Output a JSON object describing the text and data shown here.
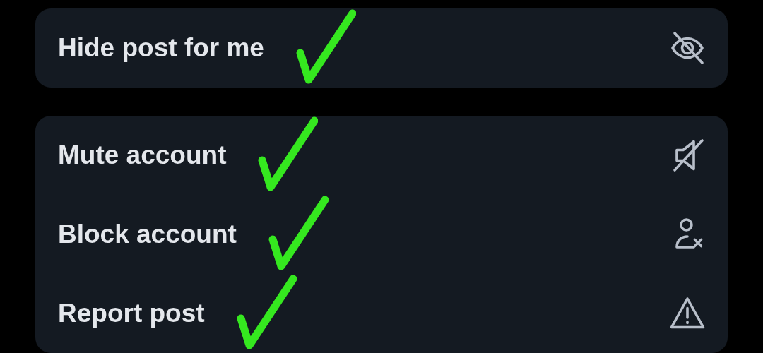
{
  "groups": [
    {
      "items": [
        {
          "label": "Hide post for me",
          "kind": "hide",
          "marked": true
        }
      ]
    },
    {
      "items": [
        {
          "label": "Mute account",
          "kind": "mute",
          "marked": true
        },
        {
          "label": "Block account",
          "kind": "block",
          "marked": true
        },
        {
          "label": "Report post",
          "kind": "report",
          "marked": true
        }
      ]
    }
  ]
}
